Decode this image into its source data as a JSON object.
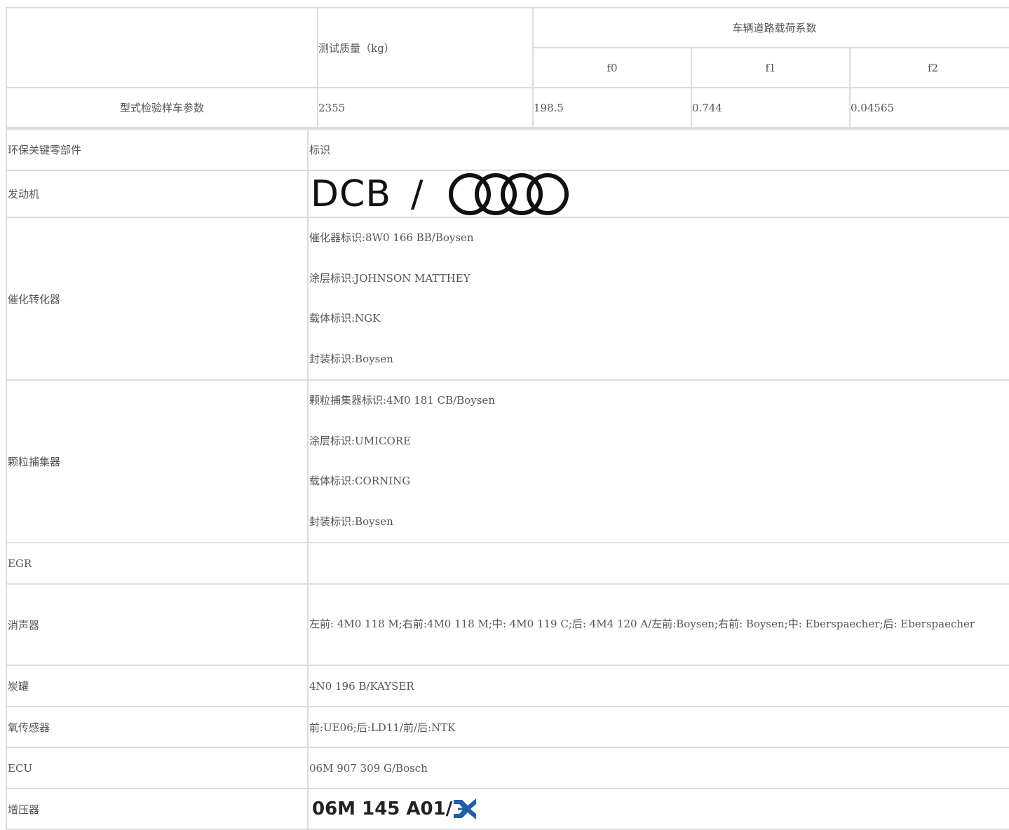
{
  "top_table": {
    "mass_header": "测试质量（kg）",
    "load_header": "车辆道路载荷系数",
    "f0_header": "f0",
    "f1_header": "f1",
    "f2_header": "f2",
    "row_label": "型式检验样车参数",
    "mass": "2355",
    "f0": "198.5",
    "f1": "0.744",
    "f2": "0.04565"
  },
  "components": {
    "header_left": "环保关键零部件",
    "header_right": "标识",
    "engine_label": "发动机",
    "engine_code": "DCB",
    "engine_slash": "/",
    "engine_logo_icon": "audi-four-rings-icon",
    "catalyst_label": "催化转化器",
    "catalyst_lines": [
      "催化器标识:8W0 166 BB/Boysen",
      "涂层标识:JOHNSON MATTHEY",
      "载体标识:NGK",
      "封装标识:Boysen"
    ],
    "particulate_label": "颗粒捕集器",
    "particulate_lines": [
      "颗粒捕集器标识:4M0 181 CB/Boysen",
      "涂层标识:UMICORE",
      "载体标识:CORNING",
      "封装标识:Boysen"
    ],
    "egr_label": "EGR",
    "egr_value": "",
    "muffler_label": "消声器",
    "muffler_value": "左前: 4M0 118 M;右前:4M0 118 M;中: 4M0 119 C;后: 4M4 120 A/左前:Boysen;右前: Boysen;中: Eberspaecher;后: Eberspaecher",
    "canister_label": "炭罐",
    "canister_value": "4N0 196 B/KAYSER",
    "o2_label": "氧传感器",
    "o2_value": "前:UE06;后:LD11/前/后:NTK",
    "ecu_label": "ECU",
    "ecu_value": "06M 907 309 G/Bosch",
    "turbo_label": "增压器",
    "turbo_code": "06M 145 A01/",
    "turbo_logo_icon": "borgwarner-logo-icon",
    "brand_color": "#1f5fa8"
  }
}
